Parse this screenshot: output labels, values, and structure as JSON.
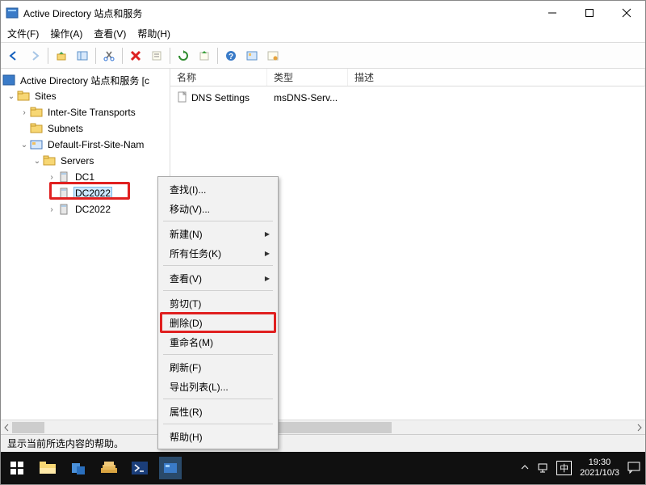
{
  "titlebar": {
    "title": "Active Directory 站点和服务"
  },
  "menubar": {
    "file": "文件(F)",
    "action": "操作(A)",
    "view": "查看(V)",
    "help": "帮助(H)"
  },
  "tree": {
    "root_label": "Active Directory 站点和服务 [c",
    "sites": "Sites",
    "inter_site": "Inter-Site Transports",
    "subnets": "Subnets",
    "default_site": "Default-First-Site-Nam",
    "servers": "Servers",
    "dc1": "DC1",
    "dc2022a": "DC2022",
    "dc2022b": "DC2022"
  },
  "list": {
    "headers": {
      "name": "名称",
      "type": "类型",
      "desc": "描述"
    },
    "row": {
      "name": "DNS Settings",
      "type": "msDNS-Serv..."
    }
  },
  "context": {
    "find": "查找(I)...",
    "move": "移动(V)...",
    "new": "新建(N)",
    "tasks": "所有任务(K)",
    "view": "查看(V)",
    "cut": "剪切(T)",
    "delete": "删除(D)",
    "rename": "重命名(M)",
    "refresh": "刷新(F)",
    "export": "导出列表(L)...",
    "props": "属性(R)",
    "help": "帮助(H)"
  },
  "status": {
    "text": "显示当前所选内容的帮助。"
  },
  "taskbar": {
    "time": "19:30",
    "date": "2021/10/3",
    "ime": "中"
  }
}
